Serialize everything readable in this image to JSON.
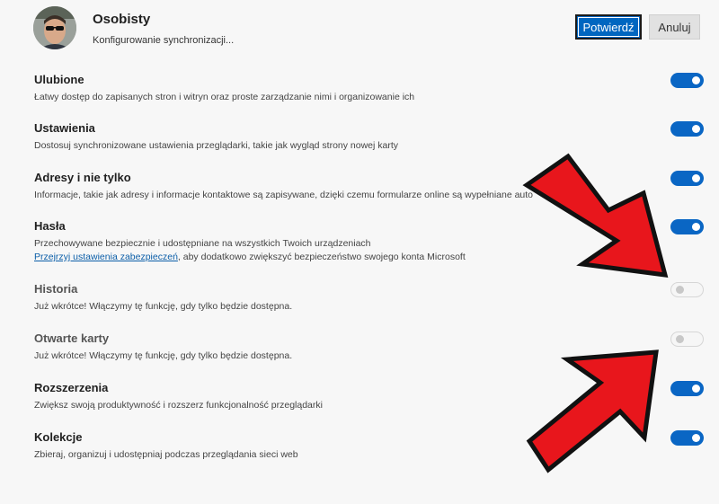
{
  "header": {
    "profile_name": "Osobisty",
    "profile_subtitle": "Konfigurowanie synchronizacji...",
    "confirm_label": "Potwierdź",
    "cancel_label": "Anuluj"
  },
  "settings": [
    {
      "title": "Ulubione",
      "desc": "Łatwy dostęp do zapisanych stron i witryn oraz proste zarządzanie nimi i organizowanie ich",
      "enabled": true
    },
    {
      "title": "Ustawienia",
      "desc": "Dostosuj synchronizowane ustawienia przeglądarki, takie jak wygląd strony nowej karty",
      "enabled": true
    },
    {
      "title": "Adresy i nie tylko",
      "desc": "Informacje, takie jak adresy i informacje kontaktowe są zapisywane, dzięki czemu formularze online są wypełniane auto",
      "enabled": true
    },
    {
      "title": "Hasła",
      "desc": "Przechowywane bezpiecznie i udostępniane na wszystkich Twoich urządzeniach",
      "link": "Przejrzyj ustawienia zabezpieczeń",
      "desc_after_link": ", aby dodatkowo zwiększyć bezpieczeństwo swojego konta Microsoft",
      "enabled": true
    },
    {
      "title": "Historia",
      "desc": "Już wkrótce! Włączymy tę funkcję, gdy tylko będzie dostępna.",
      "enabled": false
    },
    {
      "title": "Otwarte karty",
      "desc": "Już wkrótce! Włączymy tę funkcję, gdy tylko będzie dostępna.",
      "enabled": false
    },
    {
      "title": "Rozszerzenia",
      "desc": "Zwiększ swoją produktywność i rozszerz funkcjonalność przeglądarki",
      "enabled": true
    },
    {
      "title": "Kolekcje",
      "desc": "Zbieraj, organizuj i udostępniaj podczas przeglądania sieci web",
      "enabled": true
    }
  ],
  "colors": {
    "accent": "#0a66c4",
    "annotation_arrow": "#e8161c"
  }
}
